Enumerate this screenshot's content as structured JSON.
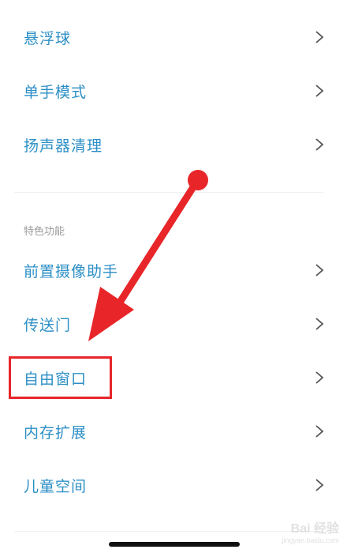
{
  "menu_top": [
    {
      "label": "悬浮球"
    },
    {
      "label": "单手模式"
    },
    {
      "label": "扬声器清理"
    }
  ],
  "section": {
    "title": "特色功能",
    "items": [
      {
        "label": "前置摄像助手"
      },
      {
        "label": "传送门"
      },
      {
        "label": "自由窗口"
      },
      {
        "label": "内存扩展"
      },
      {
        "label": "儿童空间"
      }
    ]
  },
  "annotation": {
    "arrow_color": "#e8262a",
    "highlighted_item": "自由窗口"
  },
  "colors": {
    "label_text": "#2c8fc6",
    "section_title": "#9a9a9a",
    "chevron": "#555555"
  },
  "watermark": {
    "main": "Bai 经验",
    "sub": "jingyan.baidu.com"
  }
}
